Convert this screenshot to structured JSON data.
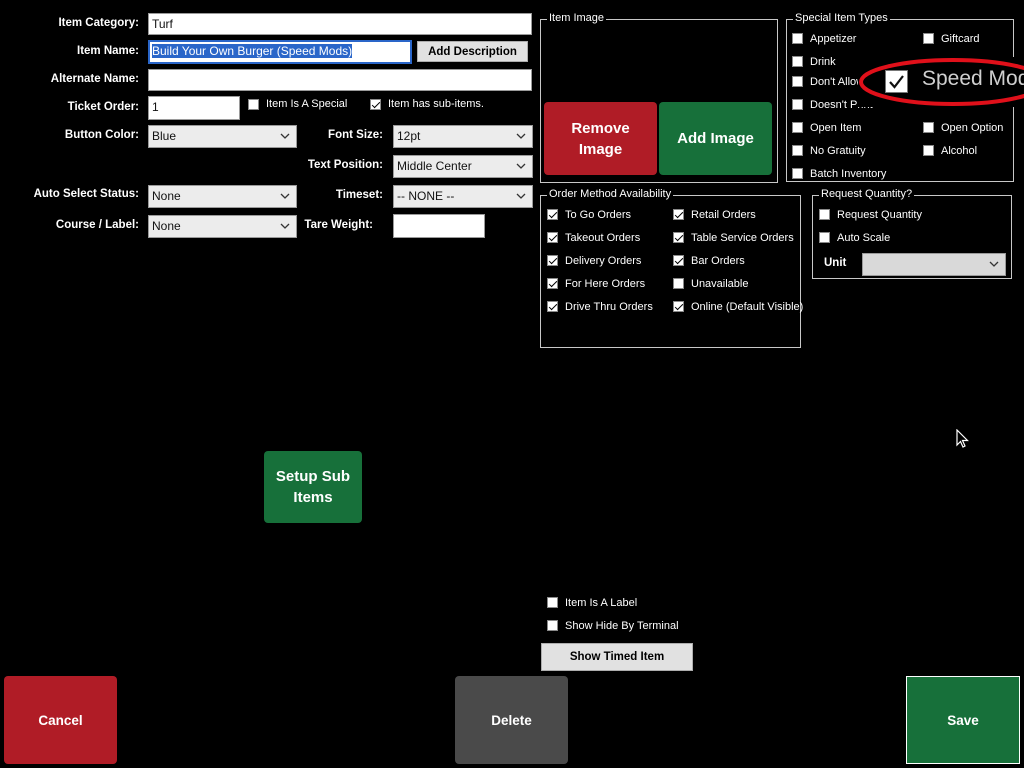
{
  "form": {
    "item_category_label": "Item Category:",
    "item_category_value": "Turf",
    "item_name_label": "Item Name:",
    "item_name_value": "Build Your Own Burger  (Speed Mods)",
    "add_description_label": "Add Description",
    "alternate_name_label": "Alternate Name:",
    "alternate_name_value": "",
    "ticket_order_label": "Ticket Order:",
    "ticket_order_value": "1",
    "item_is_special_label": "Item Is A Special",
    "item_has_subitems_label": "Item has sub-items.",
    "button_color_label": "Button Color:",
    "button_color_value": "Blue",
    "font_size_label": "Font Size:",
    "font_size_value": "12pt",
    "text_position_label": "Text Position:",
    "text_position_value": "Middle Center",
    "auto_select_label": "Auto Select Status:",
    "auto_select_value": "None",
    "timeset_label": "Timeset:",
    "timeset_value": "-- NONE --",
    "course_label": "Course / Label:",
    "course_value": "None",
    "tare_weight_label": "Tare Weight:",
    "tare_weight_value": ""
  },
  "item_image": {
    "title": "Item Image",
    "remove_label": "Remove Image",
    "add_label": "Add Image"
  },
  "special_types": {
    "title": "Special Item Types",
    "appetizer": "Appetizer",
    "giftcard": "Giftcard",
    "drink": "Drink",
    "dont_allow": "Don't Allow",
    "speed_mods": "Speed Mods",
    "doesnt_print": "Doesn't Print",
    "open_item": "Open Item",
    "open_option": "Open Option",
    "no_gratuity": "No Gratuity",
    "alcohol": "Alcohol",
    "batch_inventory": "Batch Inventory"
  },
  "order_methods": {
    "title": "Order Method Availability",
    "to_go": "To Go Orders",
    "retail": "Retail Orders",
    "takeout": "Takeout Orders",
    "table_service": "Table Service Orders",
    "delivery": "Delivery Orders",
    "bar": "Bar Orders",
    "for_here": "For Here Orders",
    "unavailable": "Unavailable",
    "drive_thru": "Drive Thru Orders",
    "online": "Online (Default Visible)"
  },
  "request_quantity": {
    "title": "Request Quantity?",
    "request_quantity": "Request Quantity",
    "auto_scale": "Auto Scale",
    "unit_label": "Unit",
    "unit_value": ""
  },
  "misc": {
    "setup_sub_items": "Setup Sub Items",
    "item_is_label": "Item Is A Label",
    "show_hide_terminal": "Show Hide By Terminal",
    "show_timed_item": "Show Timed Item"
  },
  "footer": {
    "cancel": "Cancel",
    "delete": "Delete",
    "save": "Save"
  },
  "colors": {
    "red": "#b01c26",
    "green": "#17703a",
    "gray": "#4a4a4a",
    "annotation": "#e0101a"
  }
}
